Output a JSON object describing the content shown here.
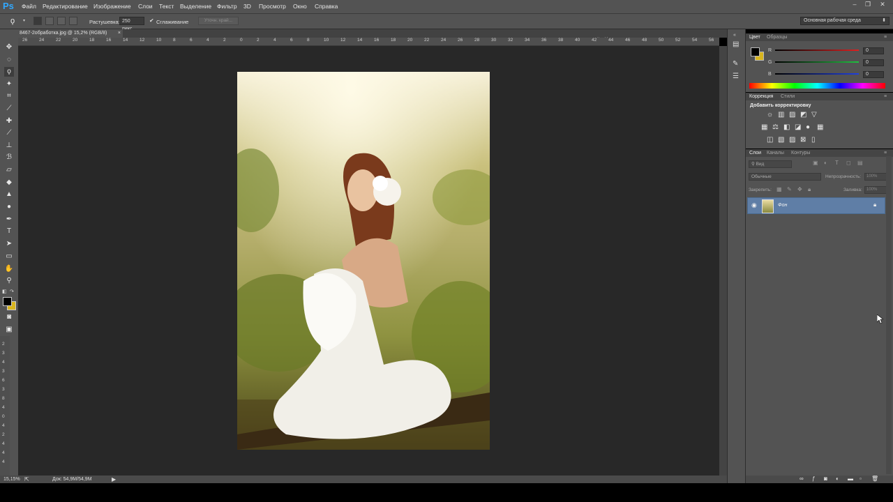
{
  "app": {
    "logo": "Ps",
    "menu": [
      "Файл",
      "Редактирование",
      "Изображение",
      "Слои",
      "Текст",
      "Выделение",
      "Фильтр",
      "3D",
      "Просмотр",
      "Окно",
      "Справка"
    ],
    "window_controls": [
      "–",
      "❐",
      "✕"
    ],
    "workspace": "Основная рабочая среда"
  },
  "options": {
    "feather_label": "Растушевка:",
    "feather_value": "250 пикс.",
    "antialias_label": "Сглаживание",
    "refine_label": "Уточн. край..."
  },
  "document": {
    "tab_title": "8467-2обработка.jpg @ 15,2% (RGB/8)",
    "close": "×"
  },
  "ruler": {
    "top_ticks": [
      "26",
      "24",
      "22",
      "20",
      "18",
      "16",
      "14",
      "12",
      "10",
      "8",
      "6",
      "4",
      "2",
      "0",
      "2",
      "4",
      "6",
      "8",
      "10",
      "12",
      "14",
      "16",
      "18",
      "20",
      "22",
      "24",
      "26",
      "28",
      "30",
      "32",
      "34",
      "36",
      "38",
      "40",
      "42",
      "44",
      "46",
      "48",
      "50",
      "52",
      "54",
      "56"
    ],
    "left_ticks": [
      "2",
      "3",
      "4",
      "3",
      "6",
      "3",
      "8",
      "4",
      "0",
      "4",
      "2",
      "4",
      "4",
      "4"
    ]
  },
  "status": {
    "zoom": "15,15%",
    "doc_info": "Док: 54,9M/54,9M"
  },
  "color_panel": {
    "tabs": [
      "Цвет",
      "Образцы"
    ],
    "channels": [
      {
        "name": "R",
        "value": "0",
        "color": "#e02020"
      },
      {
        "name": "G",
        "value": "0",
        "color": "#20c040"
      },
      {
        "name": "B",
        "value": "0",
        "color": "#2040e0"
      }
    ]
  },
  "adjustments_panel": {
    "tabs": [
      "Коррекция",
      "Стили"
    ],
    "title": "Добавить корректировку"
  },
  "layers_panel": {
    "tabs": [
      "Слои",
      "Каналы",
      "Контуры"
    ],
    "filter_kind": "Вид",
    "blend_mode": "Обычные",
    "opacity_label": "Непрозрачность:",
    "opacity_value": "100%",
    "lock_label": "Закрепить:",
    "fill_label": "Заливка:",
    "fill_value": "100%",
    "layers": [
      {
        "name": "Фон",
        "visible": true,
        "locked": true
      }
    ]
  },
  "colors": {
    "foreground": "#000000",
    "background": "#d8b51f",
    "selection": "#5f7ea6"
  }
}
